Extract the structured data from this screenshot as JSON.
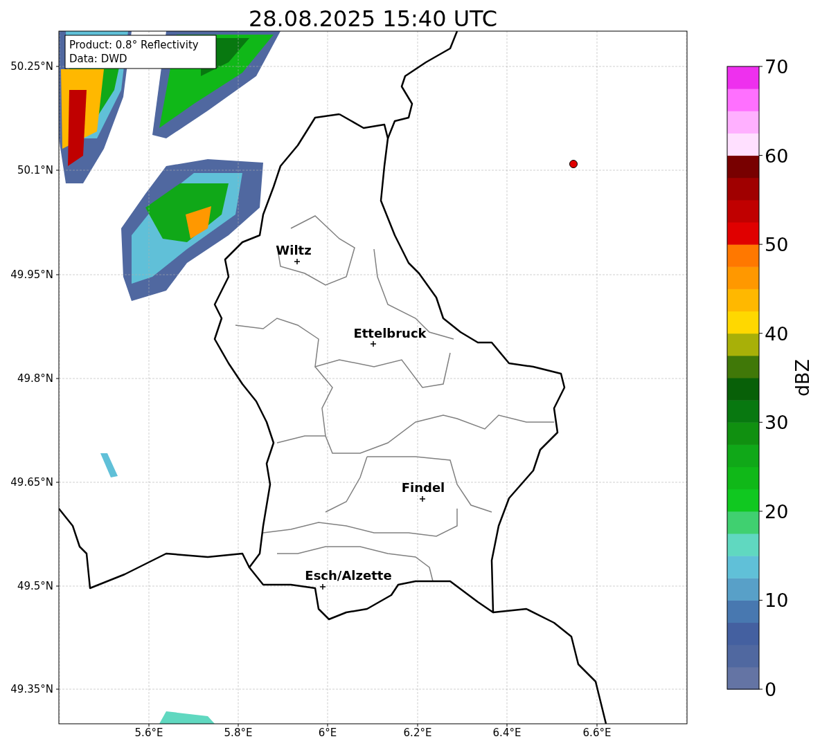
{
  "title": "28.08.2025 15:40 UTC",
  "info_box": [
    "Product: 0.8° Reflectivity",
    "Data: DWD"
  ],
  "map": {
    "lat_ticks": [
      "50.25°N",
      "50.1°N",
      "49.95°N",
      "49.8°N",
      "49.65°N",
      "49.5°N",
      "49.35°N"
    ],
    "lon_ticks": [
      "5.6°E",
      "5.8°E",
      "6°E",
      "6.2°E",
      "6.4°E",
      "6.6°E"
    ],
    "cities": [
      {
        "name": "Wiltz"
      },
      {
        "name": "Ettelbruck"
      },
      {
        "name": "Findel"
      },
      {
        "name": "Esch/Alzette"
      }
    ]
  },
  "colorbar": {
    "label": "dBZ",
    "ticks": [
      "70",
      "60",
      "50",
      "40",
      "30",
      "20",
      "10",
      "0"
    ],
    "bins": [
      {
        "color": "#6474a4"
      },
      {
        "color": "#5068a0"
      },
      {
        "color": "#4460a0"
      },
      {
        "color": "#4878b0"
      },
      {
        "color": "#58a0c8"
      },
      {
        "color": "#60c0d8"
      },
      {
        "color": "#60d8c0"
      },
      {
        "color": "#40d070"
      },
      {
        "color": "#10c820"
      },
      {
        "color": "#10b818"
      },
      {
        "color": "#10a818"
      },
      {
        "color": "#109010"
      },
      {
        "color": "#087810"
      },
      {
        "color": "#086008"
      },
      {
        "color": "#407808"
      },
      {
        "color": "#a8b008"
      },
      {
        "color": "#ffd800"
      },
      {
        "color": "#ffb800"
      },
      {
        "color": "#ff9800"
      },
      {
        "color": "#ff7800"
      },
      {
        "color": "#e00000"
      },
      {
        "color": "#c00000"
      },
      {
        "color": "#a00000"
      },
      {
        "color": "#780000"
      },
      {
        "color": "#ffe0ff"
      },
      {
        "color": "#ffb0ff"
      },
      {
        "color": "#ff70ff"
      },
      {
        "color": "#ee30ee"
      }
    ]
  }
}
